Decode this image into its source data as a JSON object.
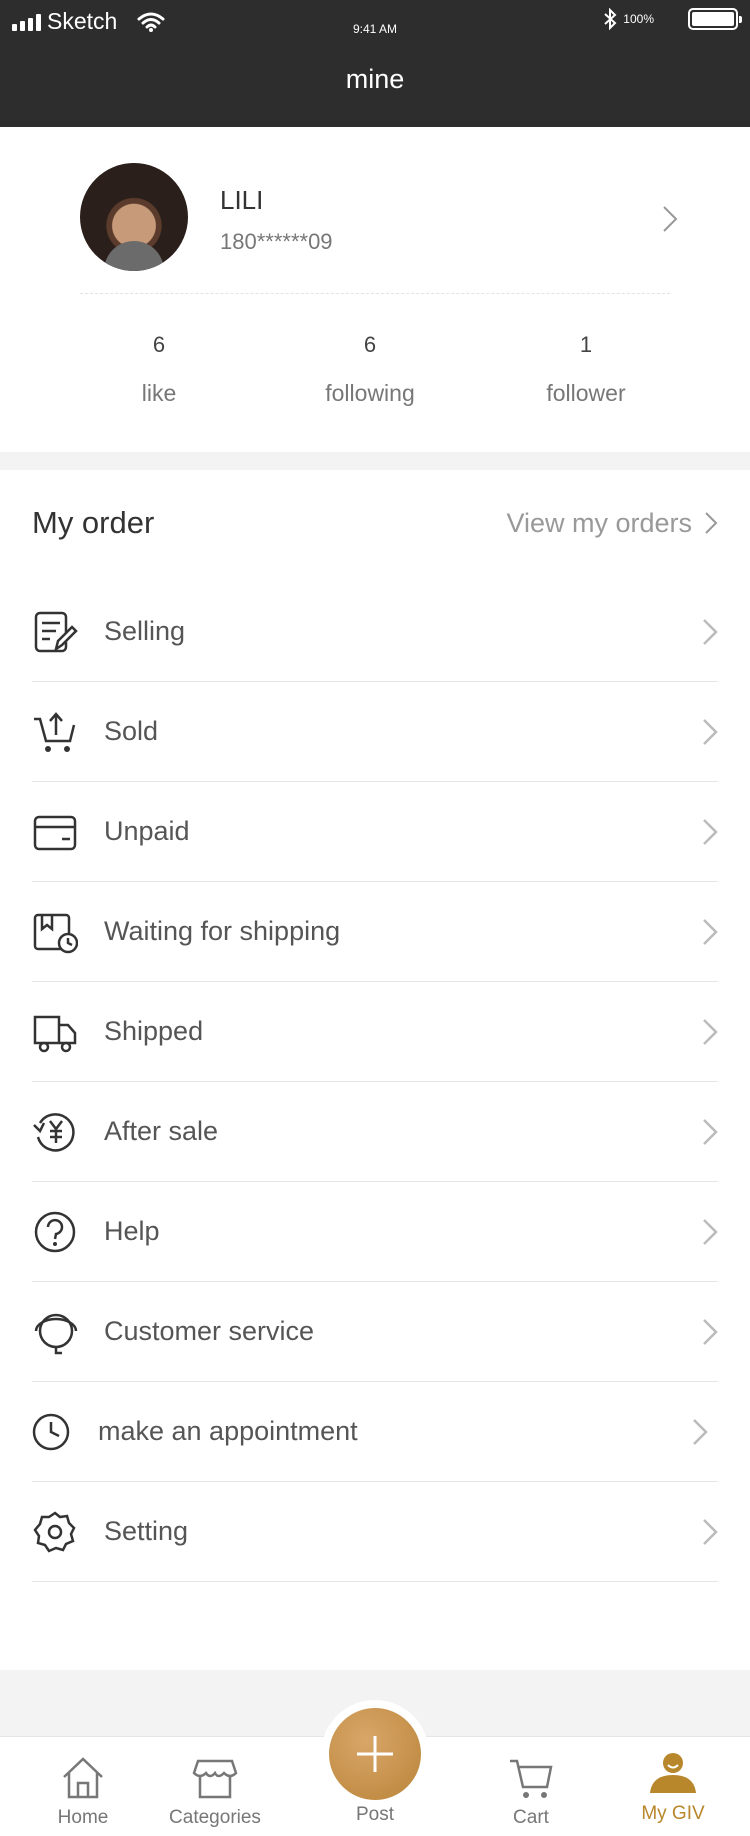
{
  "status_bar": {
    "carrier": "Sketch",
    "time": "9:41 AM",
    "battery": "100%"
  },
  "nav": {
    "title": "mine"
  },
  "profile": {
    "name": "LILI",
    "phone": "180******09",
    "stats": [
      {
        "value": "6",
        "label": "like"
      },
      {
        "value": "6",
        "label": "following"
      },
      {
        "value": "1",
        "label": "follower"
      }
    ]
  },
  "orders": {
    "title": "My order",
    "view_all": "View my orders",
    "items": [
      {
        "label": "Selling",
        "icon": "edit-document-icon"
      },
      {
        "label": "Sold",
        "icon": "cart-upload-icon"
      },
      {
        "label": "Unpaid",
        "icon": "credit-card-icon"
      },
      {
        "label": "Waiting for shipping",
        "icon": "box-clock-icon"
      },
      {
        "label": "Shipped",
        "icon": "truck-icon"
      },
      {
        "label": "After sale",
        "icon": "yen-refund-icon"
      },
      {
        "label": "Help",
        "icon": "question-icon"
      },
      {
        "label": "Customer service",
        "icon": "headset-icon"
      },
      {
        "label": "make an appointment",
        "icon": "clock-icon"
      },
      {
        "label": "Setting",
        "icon": "gear-icon"
      }
    ]
  },
  "tabbar": {
    "accent": "#b8862b",
    "tabs": [
      {
        "label": "Home",
        "icon": "home-icon"
      },
      {
        "label": "Categories",
        "icon": "shop-icon"
      },
      {
        "label": "Post",
        "icon": "plus-icon"
      },
      {
        "label": "Cart",
        "icon": "cart-icon"
      },
      {
        "label": "My GIV",
        "icon": "person-icon",
        "active": true
      }
    ]
  }
}
